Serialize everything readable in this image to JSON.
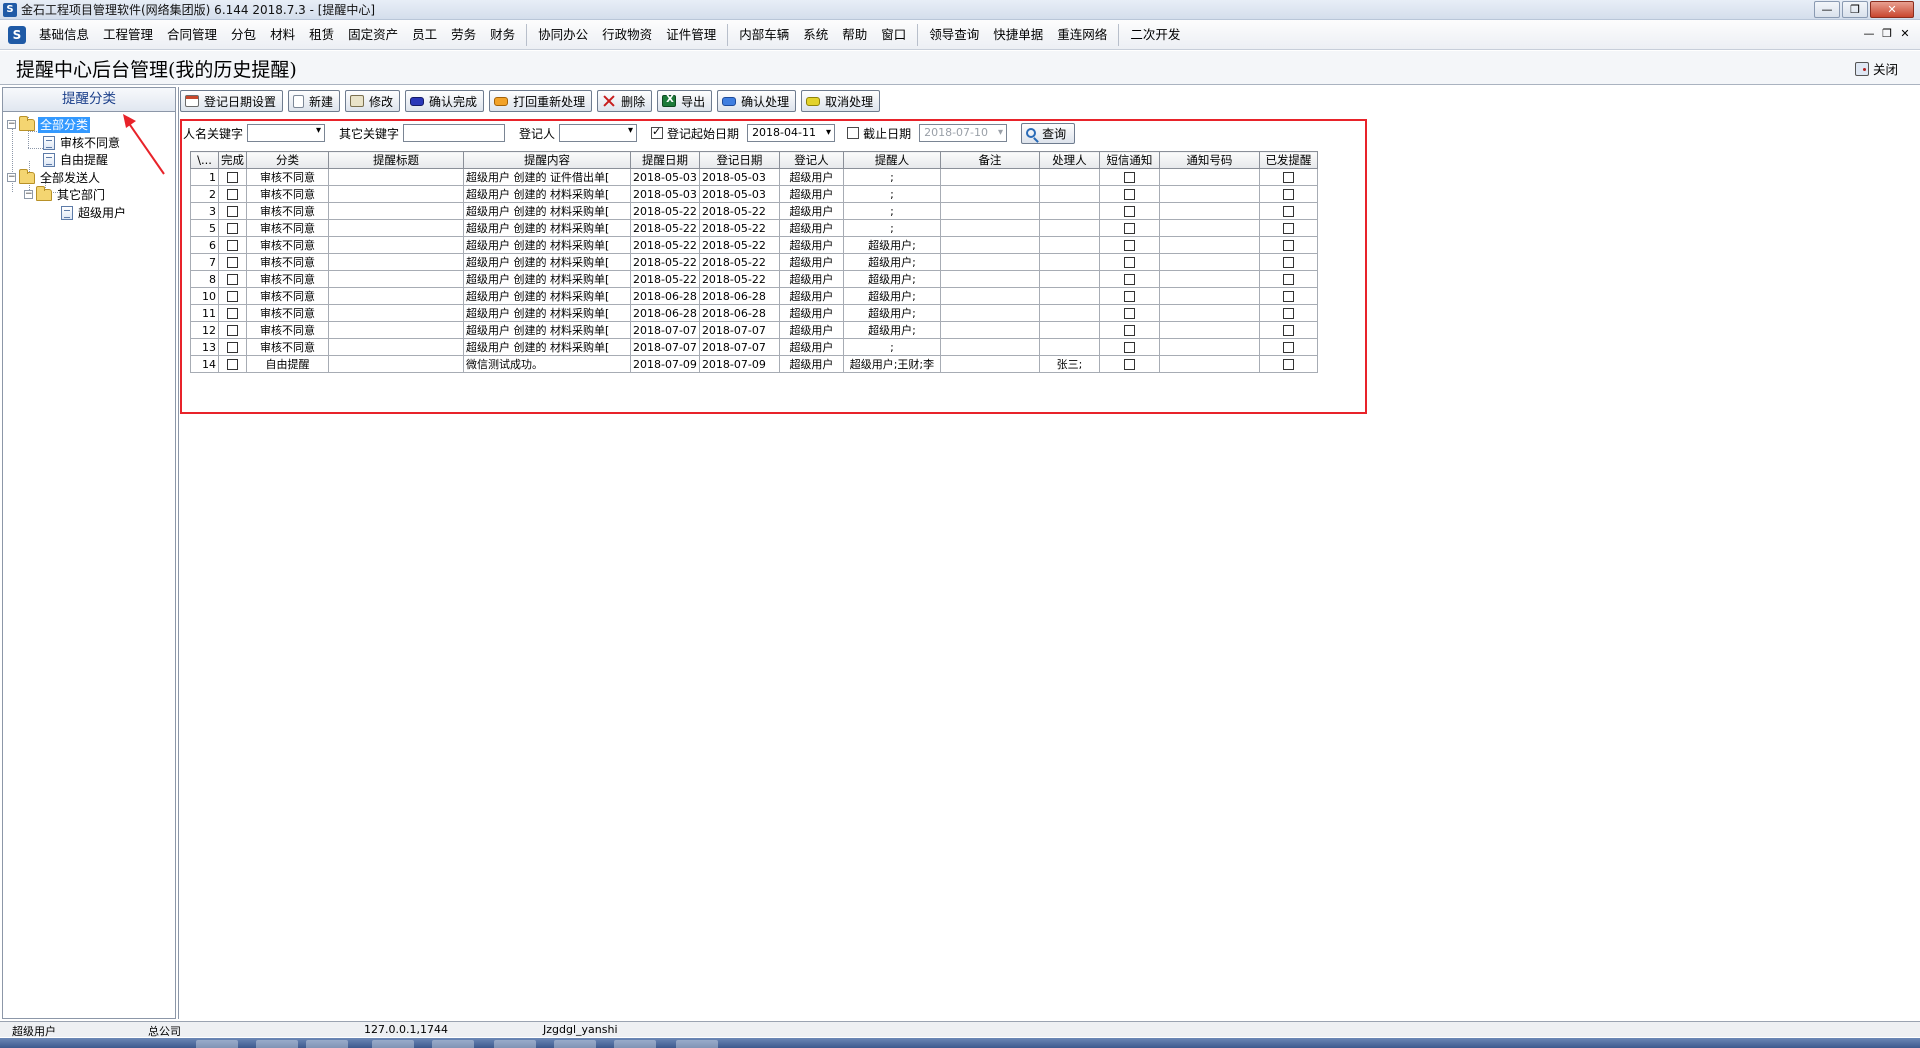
{
  "window": {
    "title": "金石工程项目管理软件(网络集团版) 6.144  2018.7.3 - [提醒中心]",
    "minimize_label": "—",
    "restore_label": "❐",
    "close_label": "✕"
  },
  "menubar": {
    "logo": "S",
    "items": [
      "基础信息",
      "工程管理",
      "合同管理",
      "分包",
      "材料",
      "租赁",
      "固定资产",
      "员工",
      "劳务",
      "财务",
      "协同办公",
      "行政物资",
      "证件管理",
      "内部车辆",
      "系统",
      "帮助",
      "窗口",
      "领导查询",
      "快捷单据",
      "重连网络",
      "二次开发"
    ],
    "mdi_minimize": "—",
    "mdi_restore": "❐",
    "mdi_close": "✕"
  },
  "page": {
    "title": "提醒中心后台管理(我的历史提醒)",
    "close_label": "关闭"
  },
  "sidebar": {
    "header": "提醒分类",
    "tree": {
      "root1": "全部分类",
      "root1_children": [
        "审核不同意",
        "自由提醒"
      ],
      "root2": "全部发送人",
      "dept": "其它部门",
      "user": "超级用户"
    },
    "expander": "−"
  },
  "toolbar": {
    "buttons": [
      "登记日期设置",
      "新建",
      "修改",
      "确认完成",
      "打回重新处理",
      "删除",
      "导出",
      "确认处理",
      "取消处理"
    ]
  },
  "filters": {
    "name_keyword_label": "人名关键字",
    "name_keyword_value": "",
    "other_keyword_label": "其它关键字",
    "other_keyword_value": "",
    "registrant_label": "登记人",
    "registrant_value": "",
    "start_date_label": "登记起始日期",
    "start_date_checked": true,
    "start_date": "2018-04-11",
    "end_date_label": "截止日期",
    "end_date_checked": false,
    "end_date": "2018-07-10",
    "query_label": "查询"
  },
  "grid": {
    "columns": [
      "\\...",
      "完成",
      "分类",
      "提醒标题",
      "提醒内容",
      "提醒日期",
      "登记日期",
      "登记人",
      "提醒人",
      "备注",
      "处理人",
      "短信通知",
      "通知号码",
      "已发提醒"
    ],
    "rows": [
      {
        "no": "1",
        "cat": "审核不同意",
        "title": "",
        "content": "超级用户 创建的 证件借出单[",
        "remind": "2018-05-03",
        "reg": "2018-05-03",
        "registrant": "超级用户",
        "reminder": ";",
        "note": "",
        "handler": "",
        "phone": ""
      },
      {
        "no": "2",
        "cat": "审核不同意",
        "title": "",
        "content": "超级用户 创建的 材料采购单[",
        "remind": "2018-05-03",
        "reg": "2018-05-03",
        "registrant": "超级用户",
        "reminder": ";",
        "note": "",
        "handler": "",
        "phone": ""
      },
      {
        "no": "3",
        "cat": "审核不同意",
        "title": "",
        "content": "超级用户 创建的 材料采购单[",
        "remind": "2018-05-22",
        "reg": "2018-05-22",
        "registrant": "超级用户",
        "reminder": ";",
        "note": "",
        "handler": "",
        "phone": ""
      },
      {
        "no": "5",
        "cat": "审核不同意",
        "title": "",
        "content": "超级用户 创建的 材料采购单[",
        "remind": "2018-05-22",
        "reg": "2018-05-22",
        "registrant": "超级用户",
        "reminder": ";",
        "note": "",
        "handler": "",
        "phone": ""
      },
      {
        "no": "6",
        "cat": "审核不同意",
        "title": "",
        "content": "超级用户 创建的 材料采购单[",
        "remind": "2018-05-22",
        "reg": "2018-05-22",
        "registrant": "超级用户",
        "reminder": "超级用户;",
        "note": "",
        "handler": "",
        "phone": ""
      },
      {
        "no": "7",
        "cat": "审核不同意",
        "title": "",
        "content": "超级用户 创建的 材料采购单[",
        "remind": "2018-05-22",
        "reg": "2018-05-22",
        "registrant": "超级用户",
        "reminder": "超级用户;",
        "note": "",
        "handler": "",
        "phone": ""
      },
      {
        "no": "8",
        "cat": "审核不同意",
        "title": "",
        "content": "超级用户 创建的 材料采购单[",
        "remind": "2018-05-22",
        "reg": "2018-05-22",
        "registrant": "超级用户",
        "reminder": "超级用户;",
        "note": "",
        "handler": "",
        "phone": ""
      },
      {
        "no": "10",
        "cat": "审核不同意",
        "title": "",
        "content": "超级用户 创建的 材料采购单[",
        "remind": "2018-06-28",
        "reg": "2018-06-28",
        "registrant": "超级用户",
        "reminder": "超级用户;",
        "note": "",
        "handler": "",
        "phone": ""
      },
      {
        "no": "11",
        "cat": "审核不同意",
        "title": "",
        "content": "超级用户 创建的 材料采购单[",
        "remind": "2018-06-28",
        "reg": "2018-06-28",
        "registrant": "超级用户",
        "reminder": "超级用户;",
        "note": "",
        "handler": "",
        "phone": ""
      },
      {
        "no": "12",
        "cat": "审核不同意",
        "title": "",
        "content": "超级用户 创建的 材料采购单[",
        "remind": "2018-07-07",
        "reg": "2018-07-07",
        "registrant": "超级用户",
        "reminder": "超级用户;",
        "note": "",
        "handler": "",
        "phone": ""
      },
      {
        "no": "13",
        "cat": "审核不同意",
        "title": "",
        "content": "超级用户 创建的 材料采购单[",
        "remind": "2018-07-07",
        "reg": "2018-07-07",
        "registrant": "超级用户",
        "reminder": ";",
        "note": "",
        "handler": "",
        "phone": ""
      },
      {
        "no": "14",
        "cat": "自由提醒",
        "title": "",
        "content": "微信测试成功。",
        "remind": "2018-07-09",
        "reg": "2018-07-09",
        "registrant": "超级用户",
        "reminder": "超级用户;王财;李",
        "note": "",
        "handler": "张三;",
        "phone": ""
      }
    ]
  },
  "statusbar": {
    "user": "超级用户",
    "company": "总公司",
    "server": "127.0.0.1,1744",
    "database": "Jzgdgl_yanshi"
  },
  "colors": {
    "annotation": "#e8232a",
    "selection": "#3399ff"
  }
}
